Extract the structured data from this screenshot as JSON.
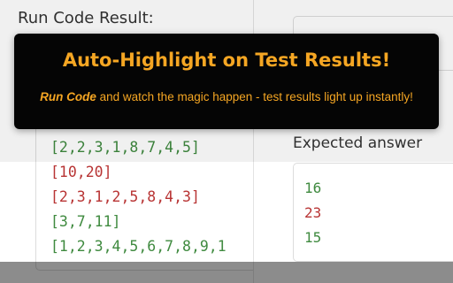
{
  "result": {
    "title": "Run Code Result:",
    "inputs": [
      "[2,2,3,1,8,7,4,5]",
      "[10,20]",
      "[2,3,1,2,5,8,4,3]",
      "[3,7,11]",
      "[1,2,3,4,5,6,7,8,9,1"
    ]
  },
  "expected": {
    "label": "Expected answer",
    "values": [
      "16",
      "23",
      "15"
    ]
  },
  "banner": {
    "title": "Auto-Highlight on Test Results!",
    "subtitle_emphasis": "Run Code",
    "subtitle_rest": " and watch the magic happen - test results light up instantly!"
  },
  "colors": {
    "banner_text": "#f5a623",
    "pass_green": "#3f8a3f",
    "fail_red": "#b83434"
  }
}
